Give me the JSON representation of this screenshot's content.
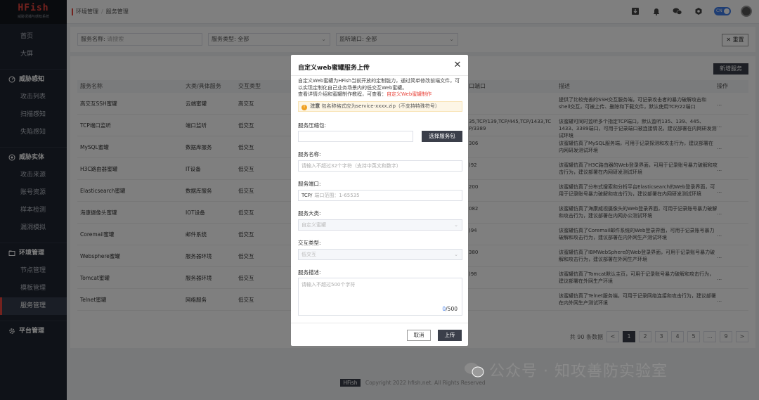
{
  "app": {
    "logo": "HFish",
    "logo_sub": "威胁诱捕与感知系统"
  },
  "sidebar": {
    "items": [
      {
        "label": "首页"
      },
      {
        "label": "大屏"
      }
    ],
    "groups": [
      {
        "label": "威胁感知",
        "icon": "radar-icon",
        "items": [
          "攻击列表",
          "扫描感知",
          "失陷感知"
        ]
      },
      {
        "label": "威胁实体",
        "icon": "target-icon",
        "items": [
          "攻击来源",
          "账号资源",
          "样本检测",
          "漏洞模拟"
        ]
      },
      {
        "label": "环境管理",
        "icon": "folder-icon",
        "items": [
          "节点管理",
          "模板管理",
          "服务管理"
        ],
        "active": "服务管理"
      },
      {
        "label": "平台管理",
        "icon": "gear-icon",
        "items": []
      }
    ]
  },
  "header": {
    "breadcrumb": [
      "环境管理",
      "服务管理"
    ],
    "toggle_label": "CN"
  },
  "filters": {
    "service_name_label": "服务名称:",
    "service_name_placeholder": "请搜索",
    "service_type_label": "服务类型:",
    "service_type_value": "全部",
    "listen_port_label": "监听端口:",
    "listen_port_value": "全部",
    "reset_label": "重置"
  },
  "table": {
    "add_button": "新增服务",
    "columns": [
      "服务名称",
      "大类/具体服务",
      "交互类型",
      "口端口",
      "描述",
      "操作"
    ],
    "rows": [
      {
        "name": "高交互SSH蜜罐",
        "category": "云端蜜罐",
        "interaction": "高交互",
        "ports": "",
        "desc": "提供了比较完善的SSH交互服务端，可记录攻击者的暴力破解攻击和shell交互，可被上传、删除和下载文件，默认使用TCP/22端口",
        "act": "..."
      },
      {
        "name": "TCP端口监听",
        "category": "端口监听",
        "interaction": "低交互",
        "ports": "35,TCP/139,TCP/445,TCP/1433,TC P/3389",
        "desc": "该蜜罐可同时监听多个指定TCP端口，默认监听135、139、445、1433、3389端口，可用于记录端口被连接情况，建议部署在内网研发测试环境",
        "act": "..."
      },
      {
        "name": "MySQL蜜罐",
        "category": "数据库服务",
        "interaction": "低交互",
        "ports": "306",
        "desc": "该蜜罐仿真了MySQL服务端，可用于记录探测和攻击行为，建议部署在内网研发测试环境",
        "act": "..."
      },
      {
        "name": "H3C路由器蜜罐",
        "category": "IT设备",
        "interaction": "低交互",
        "ports": ")92",
        "desc": "该蜜罐仿真了H3C路由器的Web登录界面，可用于记录账号暴力破解和攻击行为，建议部署在内网研发测试环境",
        "act": "..."
      },
      {
        "name": "Elasticsearch蜜罐",
        "category": "数据库服务",
        "interaction": "低交互",
        "ports": "200",
        "desc": "该蜜罐仿真了分布式搜索和分析平台Elasticsearch的Web登录界面，可用于记录账号暴力破解和攻击行为，建议部署在内网研发测试环境",
        "act": "..."
      },
      {
        "name": "海康摄像头蜜罐",
        "category": "IOT设备",
        "interaction": "低交互",
        "ports": "082",
        "desc": "该蜜罐仿真了海康威视摄像头的Web登录界面，可用于记录账号暴力破解和攻击行为，建议部署在内网办公测试环境",
        "act": "..."
      },
      {
        "name": "Coremail蜜罐",
        "category": "邮件系统",
        "interaction": "低交互",
        "ports": ")94",
        "desc": "该蜜罐仿真了Coremail邮件系统的Web登录界面，可用于记录账号暴力破解和攻击行为，建议部署在内外网生产测试环境",
        "act": "..."
      },
      {
        "name": "Websphere蜜罐",
        "category": "服务器环境",
        "interaction": "低交互",
        "ports": "380",
        "desc": "该蜜罐仿真了IBMWebSphere的Web登录界面，可用于记录账号暴力破解和攻击行为，建议部署在外网生产环境",
        "act": "..."
      },
      {
        "name": "Tomcat蜜罐",
        "category": "服务器环境",
        "interaction": "低交互",
        "ports": ")98",
        "desc": "该蜜罐仿真了Tomcat默认主页，可用于记录账号暴力破解和攻击行为，建议部署在外网生产环境",
        "act": "..."
      },
      {
        "name": "Telnet蜜罐",
        "category": "网络服务",
        "interaction": "低交互",
        "ports": "",
        "desc": "该蜜罐仿真了Telnet服务端，可用于记录网络连接和攻击行为，建议部署在内外网生产测试环境",
        "act": "..."
      }
    ]
  },
  "pagination": {
    "total": "共 90 条数据",
    "prev": "<",
    "pages": [
      "1",
      "2",
      "3",
      "4",
      "5",
      "...",
      "9"
    ],
    "next": ">"
  },
  "footer": {
    "brand": "HFish",
    "copyright": "Copyright 2022 hfish.net. All Rights Reserved"
  },
  "watermark": {
    "text": "公众号 · 知攻善防实验室"
  },
  "modal": {
    "title": "自定义web蜜罐服务上传",
    "intro": "自定义Web蜜罐为HFish当前开放的定制能力，通过简单修改前端文件，可以实现定制化自己业务场景内的低交互Web蜜罐。",
    "intro2": "查看详情介绍和蜜罐制作教程，可查看：",
    "intro_link": "自定义Web蜜罐制作",
    "notice_label": "注意",
    "notice_text": "包名称格式应为service-xxxx.zip（不支持特殊符号）",
    "pkg_label": "服务压缩包:",
    "pkg_button": "选择服务包",
    "name_label": "服务名称:",
    "name_placeholder": "请输入不超过32个字符（支持中英文和数字）",
    "port_label": "服务端口:",
    "port_prefix": "TCP/",
    "port_placeholder": "端口范围：1-65535",
    "category_label": "服务大类:",
    "category_value": "自定义蜜罐",
    "interaction_label": "交互类型:",
    "interaction_value": "低交互",
    "desc_label": "服务描述:",
    "desc_placeholder": "请输入不超过500个字符",
    "counter_current": "0",
    "counter_max": "/500",
    "cancel_label": "取消",
    "upload_label": "上传"
  }
}
